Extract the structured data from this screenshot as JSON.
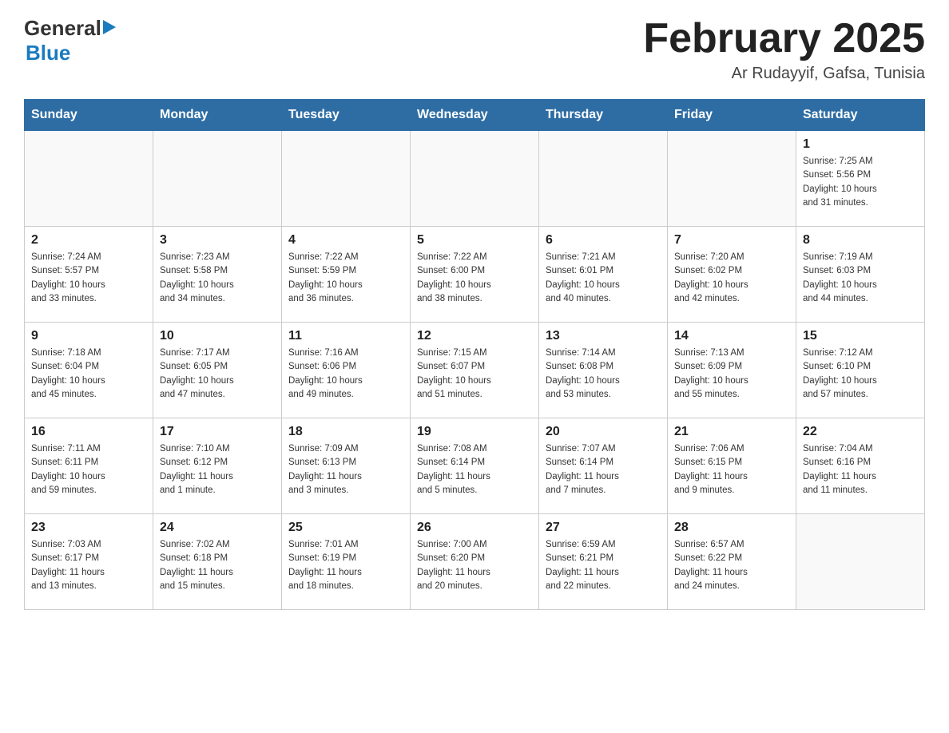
{
  "header": {
    "logo_general": "General",
    "logo_blue": "Blue",
    "month_title": "February 2025",
    "location": "Ar Rudayyif, Gafsa, Tunisia"
  },
  "weekdays": [
    "Sunday",
    "Monday",
    "Tuesday",
    "Wednesday",
    "Thursday",
    "Friday",
    "Saturday"
  ],
  "weeks": [
    [
      {
        "day": "",
        "info": ""
      },
      {
        "day": "",
        "info": ""
      },
      {
        "day": "",
        "info": ""
      },
      {
        "day": "",
        "info": ""
      },
      {
        "day": "",
        "info": ""
      },
      {
        "day": "",
        "info": ""
      },
      {
        "day": "1",
        "info": "Sunrise: 7:25 AM\nSunset: 5:56 PM\nDaylight: 10 hours\nand 31 minutes."
      }
    ],
    [
      {
        "day": "2",
        "info": "Sunrise: 7:24 AM\nSunset: 5:57 PM\nDaylight: 10 hours\nand 33 minutes."
      },
      {
        "day": "3",
        "info": "Sunrise: 7:23 AM\nSunset: 5:58 PM\nDaylight: 10 hours\nand 34 minutes."
      },
      {
        "day": "4",
        "info": "Sunrise: 7:22 AM\nSunset: 5:59 PM\nDaylight: 10 hours\nand 36 minutes."
      },
      {
        "day": "5",
        "info": "Sunrise: 7:22 AM\nSunset: 6:00 PM\nDaylight: 10 hours\nand 38 minutes."
      },
      {
        "day": "6",
        "info": "Sunrise: 7:21 AM\nSunset: 6:01 PM\nDaylight: 10 hours\nand 40 minutes."
      },
      {
        "day": "7",
        "info": "Sunrise: 7:20 AM\nSunset: 6:02 PM\nDaylight: 10 hours\nand 42 minutes."
      },
      {
        "day": "8",
        "info": "Sunrise: 7:19 AM\nSunset: 6:03 PM\nDaylight: 10 hours\nand 44 minutes."
      }
    ],
    [
      {
        "day": "9",
        "info": "Sunrise: 7:18 AM\nSunset: 6:04 PM\nDaylight: 10 hours\nand 45 minutes."
      },
      {
        "day": "10",
        "info": "Sunrise: 7:17 AM\nSunset: 6:05 PM\nDaylight: 10 hours\nand 47 minutes."
      },
      {
        "day": "11",
        "info": "Sunrise: 7:16 AM\nSunset: 6:06 PM\nDaylight: 10 hours\nand 49 minutes."
      },
      {
        "day": "12",
        "info": "Sunrise: 7:15 AM\nSunset: 6:07 PM\nDaylight: 10 hours\nand 51 minutes."
      },
      {
        "day": "13",
        "info": "Sunrise: 7:14 AM\nSunset: 6:08 PM\nDaylight: 10 hours\nand 53 minutes."
      },
      {
        "day": "14",
        "info": "Sunrise: 7:13 AM\nSunset: 6:09 PM\nDaylight: 10 hours\nand 55 minutes."
      },
      {
        "day": "15",
        "info": "Sunrise: 7:12 AM\nSunset: 6:10 PM\nDaylight: 10 hours\nand 57 minutes."
      }
    ],
    [
      {
        "day": "16",
        "info": "Sunrise: 7:11 AM\nSunset: 6:11 PM\nDaylight: 10 hours\nand 59 minutes."
      },
      {
        "day": "17",
        "info": "Sunrise: 7:10 AM\nSunset: 6:12 PM\nDaylight: 11 hours\nand 1 minute."
      },
      {
        "day": "18",
        "info": "Sunrise: 7:09 AM\nSunset: 6:13 PM\nDaylight: 11 hours\nand 3 minutes."
      },
      {
        "day": "19",
        "info": "Sunrise: 7:08 AM\nSunset: 6:14 PM\nDaylight: 11 hours\nand 5 minutes."
      },
      {
        "day": "20",
        "info": "Sunrise: 7:07 AM\nSunset: 6:14 PM\nDaylight: 11 hours\nand 7 minutes."
      },
      {
        "day": "21",
        "info": "Sunrise: 7:06 AM\nSunset: 6:15 PM\nDaylight: 11 hours\nand 9 minutes."
      },
      {
        "day": "22",
        "info": "Sunrise: 7:04 AM\nSunset: 6:16 PM\nDaylight: 11 hours\nand 11 minutes."
      }
    ],
    [
      {
        "day": "23",
        "info": "Sunrise: 7:03 AM\nSunset: 6:17 PM\nDaylight: 11 hours\nand 13 minutes."
      },
      {
        "day": "24",
        "info": "Sunrise: 7:02 AM\nSunset: 6:18 PM\nDaylight: 11 hours\nand 15 minutes."
      },
      {
        "day": "25",
        "info": "Sunrise: 7:01 AM\nSunset: 6:19 PM\nDaylight: 11 hours\nand 18 minutes."
      },
      {
        "day": "26",
        "info": "Sunrise: 7:00 AM\nSunset: 6:20 PM\nDaylight: 11 hours\nand 20 minutes."
      },
      {
        "day": "27",
        "info": "Sunrise: 6:59 AM\nSunset: 6:21 PM\nDaylight: 11 hours\nand 22 minutes."
      },
      {
        "day": "28",
        "info": "Sunrise: 6:57 AM\nSunset: 6:22 PM\nDaylight: 11 hours\nand 24 minutes."
      },
      {
        "day": "",
        "info": ""
      }
    ]
  ]
}
